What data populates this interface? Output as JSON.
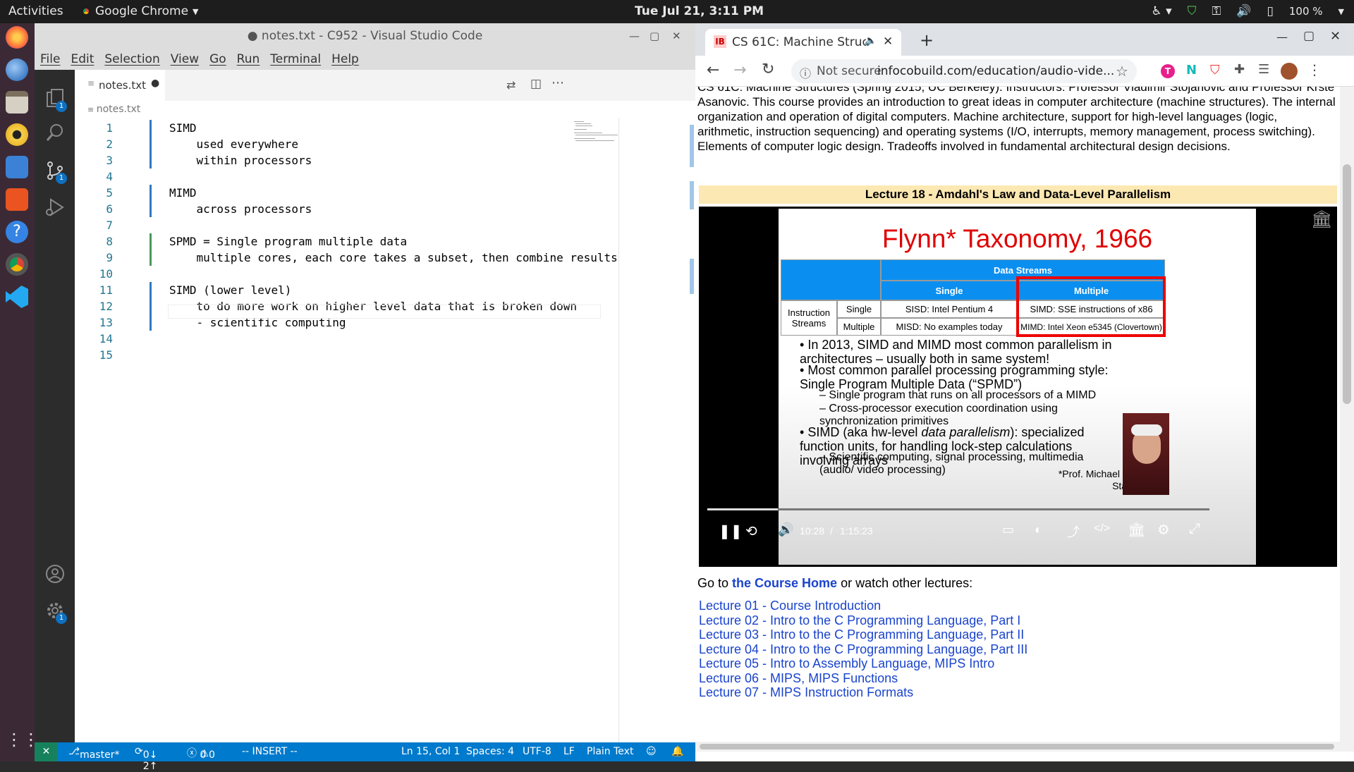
{
  "topbar": {
    "activities": "Activities",
    "app_name": "Google Chrome",
    "clock": "Tue Jul 21,  3:11 PM",
    "battery": "100 %"
  },
  "vscode": {
    "window_title": "● notes.txt - C952 - Visual Studio Code",
    "menu": [
      "File",
      "Edit",
      "Selection",
      "View",
      "Go",
      "Run",
      "Terminal",
      "Help"
    ],
    "tab_label": "notes.txt",
    "breadcrumb": "notes.txt",
    "lines": [
      {
        "n": "1",
        "text": "SIMD"
      },
      {
        "n": "2",
        "text": "    used everywhere"
      },
      {
        "n": "3",
        "text": "    within processors"
      },
      {
        "n": "4",
        "text": ""
      },
      {
        "n": "5",
        "text": "MIMD"
      },
      {
        "n": "6",
        "text": "    across processors"
      },
      {
        "n": "7",
        "text": ""
      },
      {
        "n": "8",
        "text": "SPMD = Single program multiple data"
      },
      {
        "n": "9",
        "text": "    multiple cores, each core takes a subset, then combine results"
      },
      {
        "n": "10",
        "text": ""
      },
      {
        "n": "11",
        "text": "SIMD (lower level)"
      },
      {
        "n": "12",
        "text": "    to do more work on higher level data that is broken down"
      },
      {
        "n": "13",
        "text": "    - scientific computing"
      },
      {
        "n": "14",
        "text": ""
      },
      {
        "n": "15",
        "text": ""
      }
    ],
    "status": {
      "branch": "master*",
      "sync": "0↓ 2↑",
      "problems": "0",
      "warnings": "0",
      "mode": "-- INSERT --",
      "position": "Ln 15, Col 1",
      "spaces": "Spaces: 4",
      "encoding": "UTF-8",
      "eol": "LF",
      "language": "Plain Text"
    },
    "badges": {
      "explorer": "1",
      "scm": "1",
      "settings": "1"
    }
  },
  "chrome": {
    "tab_title": "CS 61C: Machine Struc",
    "not_secure": "Not secure",
    "url": "infocobuild.com/education/audio-vide...",
    "description": "CS 61C: Machine Structures (Spring 2015, UC Berkeley). Instructors: Professor Vladimir Stojanovic and Professor Krste Asanovic. This course provides an introduction to great ideas in computer architecture (machine structures). The internal organization and operation of digital computers. Machine architecture, support for high-level languages (logic, arithmetic, instruction sequencing) and operating systems (I/O, interrupts, memory management, process switching). Elements of computer logic design. Tradeoffs involved in fundamental architectural design decisions.",
    "lecture_heading": "Lecture 18 - Amdahl's Law and Data-Level Parallelism",
    "slide": {
      "title": "Flynn* Taxonomy, 1966",
      "data_streams": "Data Streams",
      "single_col": "Single",
      "multiple_col": "Multiple",
      "instruction_streams": "Instruction Streams",
      "row_single": "Single",
      "row_multiple": "Multiple",
      "sisd": "SISD: Intel Pentium 4",
      "simd": "SIMD: SSE instructions of x86",
      "misd": "MISD: No examples today",
      "mimd": "MIMD: Intel Xeon e5345 (Clovertown)",
      "b1": "In 2013, SIMD and MIMD most common parallelism in architectures – usually both in same system!",
      "b2": "Most common parallel processing programming style: Single Program Multiple Data (“SPMD”)",
      "b2a": "Single program that runs on all processors of a MIMD",
      "b2b": "Cross-processor execution coordination using synchronization primitives",
      "b3_pre": "SIMD (aka hw-level ",
      "b3_em": "data parallelism",
      "b3_post": "): specialized function units, for handling lock-step calculations involving arrays",
      "b3a": "Scientific computing, signal processing, multimedia (audio/ video processing)",
      "footnote": "*Prof. Michael Flynn, Stanford"
    },
    "video": {
      "time_current": "10:28",
      "time_sep": "/",
      "time_total": "1:15:23",
      "progress": 0.14
    },
    "goto_pre": "Go to ",
    "goto_link": "the Course Home",
    "goto_post": " or watch other lectures:",
    "lectures": [
      "Lecture 01 - Course Introduction",
      "Lecture 02 - Intro to the C Programming Language, Part I",
      "Lecture 03 - Intro to the C Programming Language, Part II",
      "Lecture 04 - Intro to the C Programming Language, Part III",
      "Lecture 05 - Intro to Assembly Language, MIPS Intro",
      "Lecture 06 - MIPS, MIPS Functions",
      "Lecture 07 - MIPS Instruction Formats"
    ]
  }
}
